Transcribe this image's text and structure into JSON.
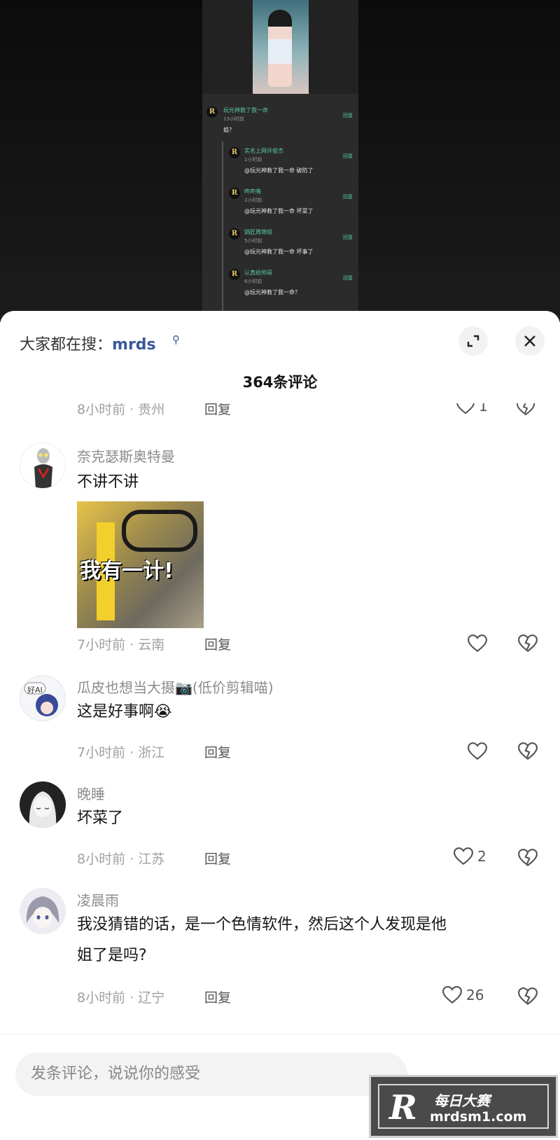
{
  "video": {
    "mini_comments": [
      {
        "name": "玩元神救了我一命",
        "time": "13小时前",
        "text": "姐?",
        "reply": "回复"
      },
      {
        "name": "实名上网许俊杰",
        "time": "1小时前",
        "text": "@玩元神救了我一命 破防了",
        "reply": "回复"
      },
      {
        "name": "咚咚咯",
        "time": "2小时前",
        "text": "@玩元神救了我一命 坏菜了",
        "reply": "回复"
      },
      {
        "name": "锅匠周锦锐",
        "time": "5小时前",
        "text": "@玩元神救了我一命 坏事了",
        "reply": "回复"
      },
      {
        "name": "认真给帅哥",
        "time": "6小时前",
        "text": "@玩元神救了我一命？",
        "reply": "回复"
      }
    ],
    "logo_letter": "R"
  },
  "sheet": {
    "search_prefix": "大家都在搜：",
    "search_keyword": "mrds",
    "comment_count": "364条评论"
  },
  "comments": [
    {
      "meta": "8小时前 · 贵州",
      "reply": "回复",
      "likes": "1"
    },
    {
      "user": "奈克瑟斯奥特曼",
      "text": "不讲不讲",
      "meme_caption": "我有一计!",
      "meta": "7小时前 · 云南",
      "reply": "回复",
      "likes": ""
    },
    {
      "user": "瓜皮也想当大摄📷(低价剪辑喵)",
      "avatar_badge": "好AI",
      "text": "这是好事啊😭",
      "meta": "7小时前 · 浙江",
      "reply": "回复",
      "likes": ""
    },
    {
      "user": "晚睡",
      "text": "坏菜了",
      "meta": "8小时前 · 江苏",
      "reply": "回复",
      "likes": "2"
    },
    {
      "user": "凌晨雨",
      "text_line1": "我没猜错的话，是一个色情软件，然后这个人发现是他",
      "text_line2": "姐了是吗?",
      "meta": "8小时前 · 辽宁",
      "reply": "回复",
      "likes": "26"
    }
  ],
  "input": {
    "placeholder": "发条评论，说说你的感受"
  },
  "watermark": {
    "letter": "R",
    "title": "每日大赛",
    "url": "mrdsm1.com"
  },
  "colors": {
    "accent_link": "#3b5998",
    "mini_name": "#59c9a9"
  }
}
